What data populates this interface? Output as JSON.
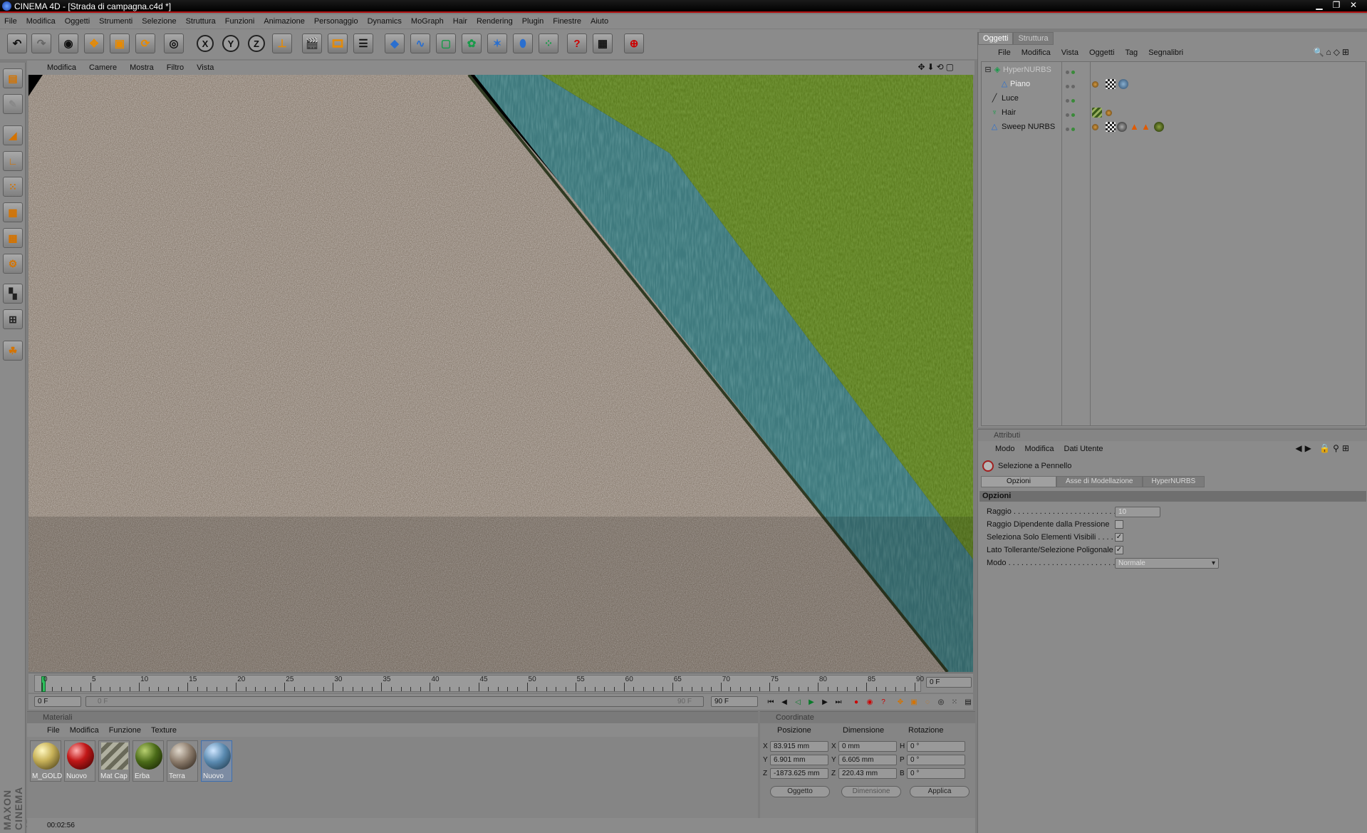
{
  "window": {
    "title": "CINEMA 4D - [Strada di campagna.c4d *]",
    "controls": [
      "▁",
      "❐",
      "✕"
    ]
  },
  "menubar": [
    "File",
    "Modifica",
    "Oggetti",
    "Strumenti",
    "Selezione",
    "Struttura",
    "Funzioni",
    "Animazione",
    "Personaggio",
    "Dynamics",
    "MoGraph",
    "Hair",
    "Rendering",
    "Plugin",
    "Finestre",
    "Aiuto"
  ],
  "toolbar": {
    "axis_x": "X",
    "axis_y": "Y",
    "axis_z": "Z"
  },
  "viewport": {
    "menu": [
      "Modifica",
      "Camere",
      "Mostra",
      "Filtro",
      "Vista"
    ]
  },
  "timeline": {
    "ticks": [
      "0",
      "5",
      "10",
      "15",
      "20",
      "25",
      "30",
      "35",
      "40",
      "45",
      "50",
      "55",
      "60",
      "65",
      "70",
      "75",
      "80",
      "85",
      "90"
    ],
    "current_frame": "0 F",
    "start_field": "0 F",
    "range_start": "0 F",
    "range_end": "90 F",
    "end_field": "90 F"
  },
  "materials": {
    "header": "Materiali",
    "menu": [
      "File",
      "Modifica",
      "Funzione",
      "Texture"
    ],
    "items": [
      {
        "label": "M_GOLD",
        "color": "#c9b35a"
      },
      {
        "label": "Nuovo",
        "color": "#c21818"
      },
      {
        "label": "Mat Cap",
        "color": "#9a9a8a"
      },
      {
        "label": "Erba",
        "color": "#4a6a18"
      },
      {
        "label": "Terra",
        "color": "#8a7a6a"
      },
      {
        "label": "Nuovo",
        "color": "#5a8ab0"
      }
    ]
  },
  "coords": {
    "header": "Coordinate",
    "col_pos": "Posizione",
    "col_dim": "Dimensione",
    "col_rot": "Rotazione",
    "rows": [
      {
        "axis": "X",
        "pos": "83.915 mm",
        "daxis": "X",
        "dim": "0 mm",
        "raxis": "H",
        "rot": "0 °"
      },
      {
        "axis": "Y",
        "pos": "6.901 mm",
        "daxis": "Y",
        "dim": "6.605 mm",
        "raxis": "P",
        "rot": "0 °"
      },
      {
        "axis": "Z",
        "pos": "-1873.625 mm",
        "daxis": "Z",
        "dim": "220.43 mm",
        "raxis": "B",
        "rot": "0 °"
      }
    ],
    "btn_mode": "Oggetto",
    "btn_dim": "Dimensione",
    "btn_apply": "Applica"
  },
  "status": {
    "time": "00:02:56"
  },
  "maxon_logo": "MAXON CINEMA 4D",
  "objects": {
    "tabs": [
      "Oggetti",
      "Struttura"
    ],
    "menu": [
      "File",
      "Modifica",
      "Vista",
      "Oggetti",
      "Tag",
      "Segnalibri"
    ],
    "items": [
      {
        "name": "HyperNURBS",
        "icon": "hypernurbs-icon",
        "indent": 0
      },
      {
        "name": "Piano",
        "icon": "plane-icon",
        "indent": 1
      },
      {
        "name": "Luce",
        "icon": "light-icon",
        "indent": 0
      },
      {
        "name": "Hair",
        "icon": "hair-icon",
        "indent": 0
      },
      {
        "name": "Sweep NURBS",
        "icon": "sweep-nurbs-icon",
        "indent": 0
      }
    ]
  },
  "attributes": {
    "header": "Attributi",
    "menu": [
      "Modo",
      "Modifica",
      "Dati Utente"
    ],
    "tool_name": "Selezione a Pennello",
    "tabs": [
      "Opzioni",
      "Asse di Modellazione",
      "HyperNURBS"
    ],
    "section": "Opzioni",
    "rows": [
      {
        "label": "Raggio . . . . . . . . . . . . . . . . . . . . . . . . . . . .",
        "type": "number",
        "value": "10"
      },
      {
        "label": "Raggio Dipendente dalla Pressione",
        "type": "check",
        "checked": false
      },
      {
        "label": "Seleziona Solo Elementi Visibili . . . . .",
        "type": "check",
        "checked": true
      },
      {
        "label": "Lato Tollerante/Selezione Poligonale",
        "type": "check",
        "checked": true
      },
      {
        "label": "Modo . . . . . . . . . . . . . . . . . . . . . . . . . . . . . .",
        "type": "select",
        "value": "Normale"
      }
    ]
  },
  "colors": {
    "accent": "#b01010",
    "panel": "#8b8b8b",
    "playhead": "#2ec05c",
    "water": "#3e7e82",
    "grass": "#5a7a1e",
    "road": "#8a7f74"
  }
}
